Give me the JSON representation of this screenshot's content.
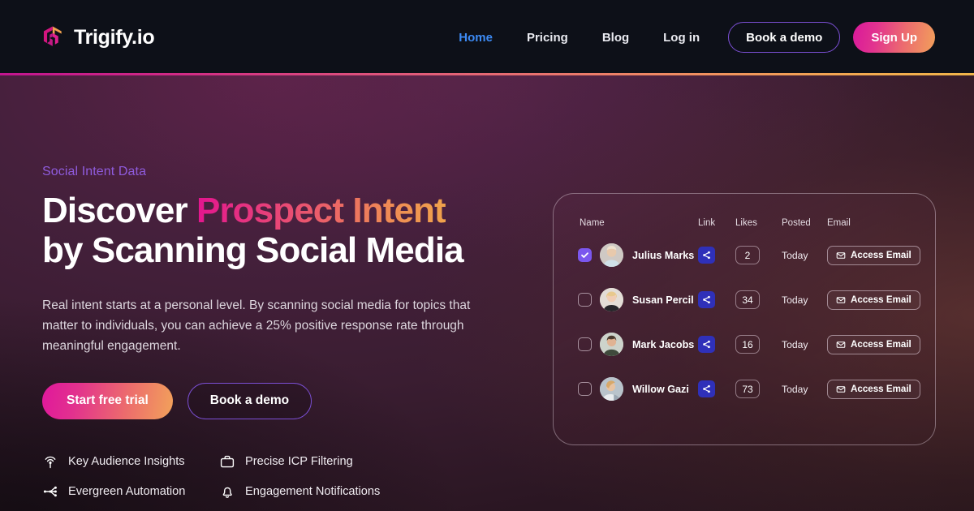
{
  "brand": {
    "name": "Trigify.io",
    "logo_icon": "trigify-triskelion-logo",
    "colors": {
      "magenta": "#d9189b",
      "orange": "#f2a050",
      "purple": "#7b4fd4",
      "blue": "#3d8bf5"
    }
  },
  "nav": {
    "links": [
      {
        "label": "Home",
        "active": true
      },
      {
        "label": "Pricing",
        "active": false
      },
      {
        "label": "Blog",
        "active": false
      },
      {
        "label": "Log in",
        "active": false
      }
    ],
    "book_demo_label": "Book a demo",
    "sign_up_label": "Sign Up"
  },
  "hero": {
    "eyebrow": "Social Intent Data",
    "headline_line1_plain": "Discover ",
    "headline_line1_gradient": "Prospect Intent",
    "headline_line2": "by Scanning Social Media",
    "subcopy": "Real intent starts at a personal level. By scanning social media for topics that matter to individuals, you can achieve a 25% positive response rate through meaningful engagement.",
    "cta_primary": "Start free trial",
    "cta_secondary": "Book a demo",
    "features": [
      {
        "label": "Key Audience Insights",
        "icon": "radar-signal-icon"
      },
      {
        "label": "Precise ICP Filtering",
        "icon": "briefcase-icon"
      },
      {
        "label": "Evergreen Automation",
        "icon": "workflow-nodes-icon"
      },
      {
        "label": "Engagement Notifications",
        "icon": "bell-icon"
      }
    ]
  },
  "table": {
    "columns": [
      "Name",
      "Link",
      "Likes",
      "Posted",
      "Email"
    ],
    "access_email_label": "Access Email",
    "rows": [
      {
        "name": "Julius Marks",
        "selected": true,
        "likes": "2",
        "posted": "Today",
        "link_icon": "share-icon",
        "email_icon": "envelope-icon",
        "avatar": "avatar-julius"
      },
      {
        "name": "Susan Percil",
        "selected": false,
        "likes": "34",
        "posted": "Today",
        "link_icon": "share-icon",
        "email_icon": "envelope-icon",
        "avatar": "avatar-susan"
      },
      {
        "name": "Mark Jacobs",
        "selected": false,
        "likes": "16",
        "posted": "Today",
        "link_icon": "share-icon",
        "email_icon": "envelope-icon",
        "avatar": "avatar-mark"
      },
      {
        "name": "Willow Gazi",
        "selected": false,
        "likes": "73",
        "posted": "Today",
        "link_icon": "share-icon",
        "email_icon": "envelope-icon",
        "avatar": "avatar-willow"
      }
    ]
  }
}
